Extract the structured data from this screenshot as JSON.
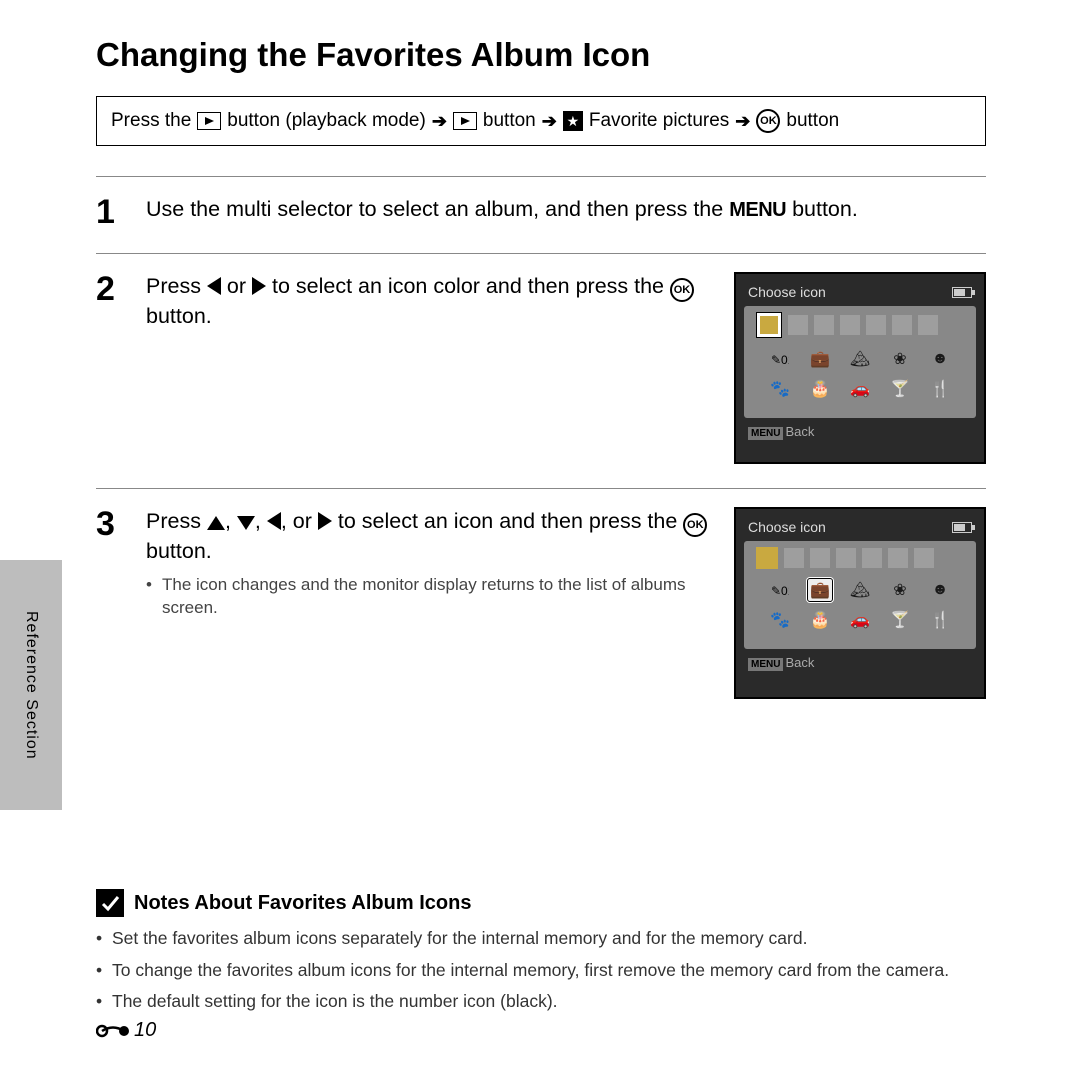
{
  "title": "Changing the Favorites Album Icon",
  "nav": {
    "press_the": "Press the",
    "playback_mode": "button (playback mode)",
    "button": "button",
    "favorite_pictures": "Favorite pictures"
  },
  "steps": {
    "s1": {
      "num": "1",
      "text_a": "Use the multi selector to select an album, and then press the ",
      "menu": "MENU",
      "text_b": " button."
    },
    "s2": {
      "num": "2",
      "text_a": "Press ",
      "text_mid": " or ",
      "text_b": " to select an icon color and then press the ",
      "text_c": " button."
    },
    "s3": {
      "num": "3",
      "text_a": "Press ",
      "comma": ", ",
      "or": ", or ",
      "text_b": " to select an icon and then press the ",
      "text_c": " button.",
      "bullet": "The icon changes and the monitor display returns to the list of albums screen."
    }
  },
  "lcd": {
    "title": "Choose icon",
    "back": "Back",
    "menu": "MENU"
  },
  "notes": {
    "heading": "Notes About Favorites Album Icons",
    "items": [
      "Set the favorites album icons separately for the internal memory and for the memory card.",
      "To change the favorites album icons for the internal memory, first remove the memory card from the camera.",
      "The default setting for the icon is the number icon (black)."
    ]
  },
  "side_tab": "Reference Section",
  "page_number": "10",
  "ok_label": "OK"
}
